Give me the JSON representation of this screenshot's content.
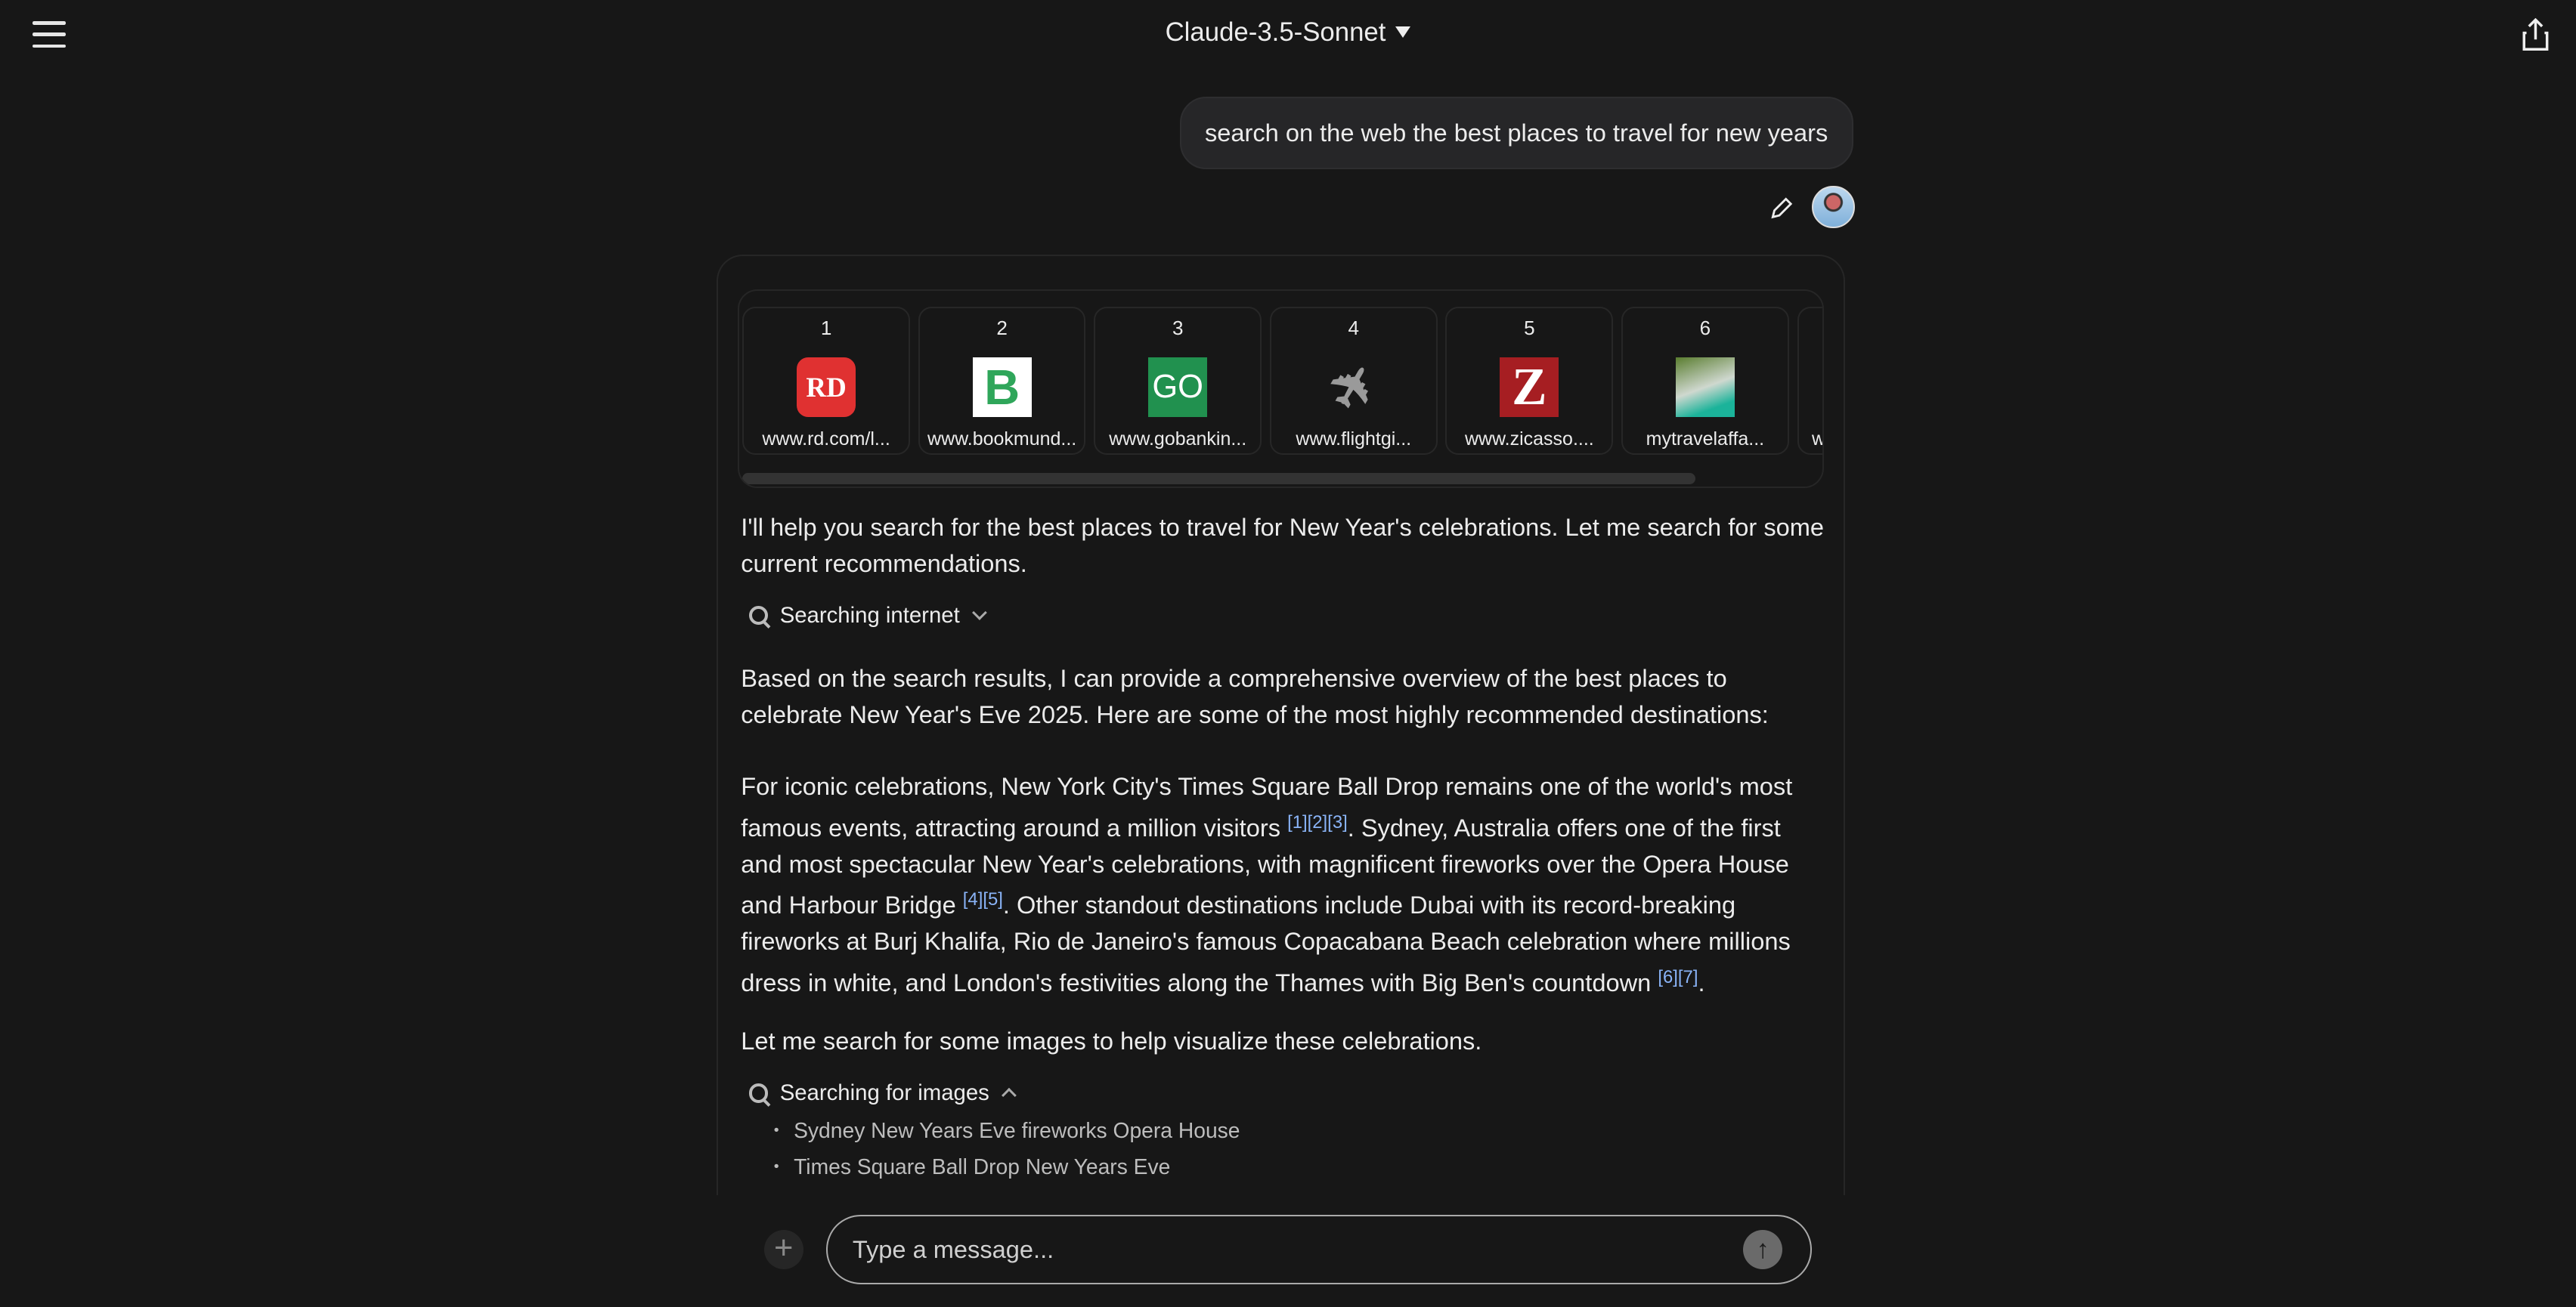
{
  "header": {
    "title": "Claude-3.5-Sonnet"
  },
  "user_message": {
    "text": "search on the web the best places to travel for new years"
  },
  "sources": [
    {
      "num": "1",
      "label": "www.rd.com/l...",
      "icon": "RD",
      "color": "#e03131"
    },
    {
      "num": "2",
      "label": "www.bookmund...",
      "icon": "B",
      "color": "#ffffff"
    },
    {
      "num": "3",
      "label": "www.gobankin...",
      "icon": "GO",
      "color": "#21914f"
    },
    {
      "num": "4",
      "label": "www.flightgi...",
      "icon": "plane-icon",
      "color": "#9a9a9a"
    },
    {
      "num": "5",
      "label": "www.zicasso....",
      "icon": "Z",
      "color": "#a61e22"
    },
    {
      "num": "6",
      "label": "mytravelaffa...",
      "icon": "photo-thumbnail",
      "color": "#4a7a3a"
    },
    {
      "num": "",
      "label": "w",
      "icon": "",
      "color": ""
    }
  ],
  "response": {
    "intro": "I'll help you search for the best places to travel for New Year's celebrations. Let me search for some current recommendations.",
    "tool1": "Searching internet",
    "p2": "Based on the search results, I can provide a comprehensive overview of the best places to celebrate New Year's Eve 2025. Here are some of the most highly recommended destinations:",
    "p3": [
      "For iconic celebrations, New York City's Times Square Ball Drop remains one of the world's most famous events, attracting around a million visitors ",
      "[1][2][3]",
      ". Sydney, Australia offers one of the first and most spectacular New Year's celebrations, with magnificent fireworks over the Opera House and Harbour Bridge ",
      "[4][5]",
      ". Other standout destinations include Dubai with its record-breaking fireworks at Burj Khalifa, Rio de Janeiro's famous Copacabana Beach celebration where millions dress in white, and London's festivities along the Thames with Big Ben's countdown ",
      "[6][7]",
      "."
    ],
    "p4": "Let me search for some images to help visualize these celebrations.",
    "tool2": "Searching for images",
    "queries": [
      "Sydney New Years Eve fireworks Opera House",
      "Times Square Ball Drop New Years Eve"
    ]
  },
  "composer": {
    "placeholder": "Type a message..."
  }
}
